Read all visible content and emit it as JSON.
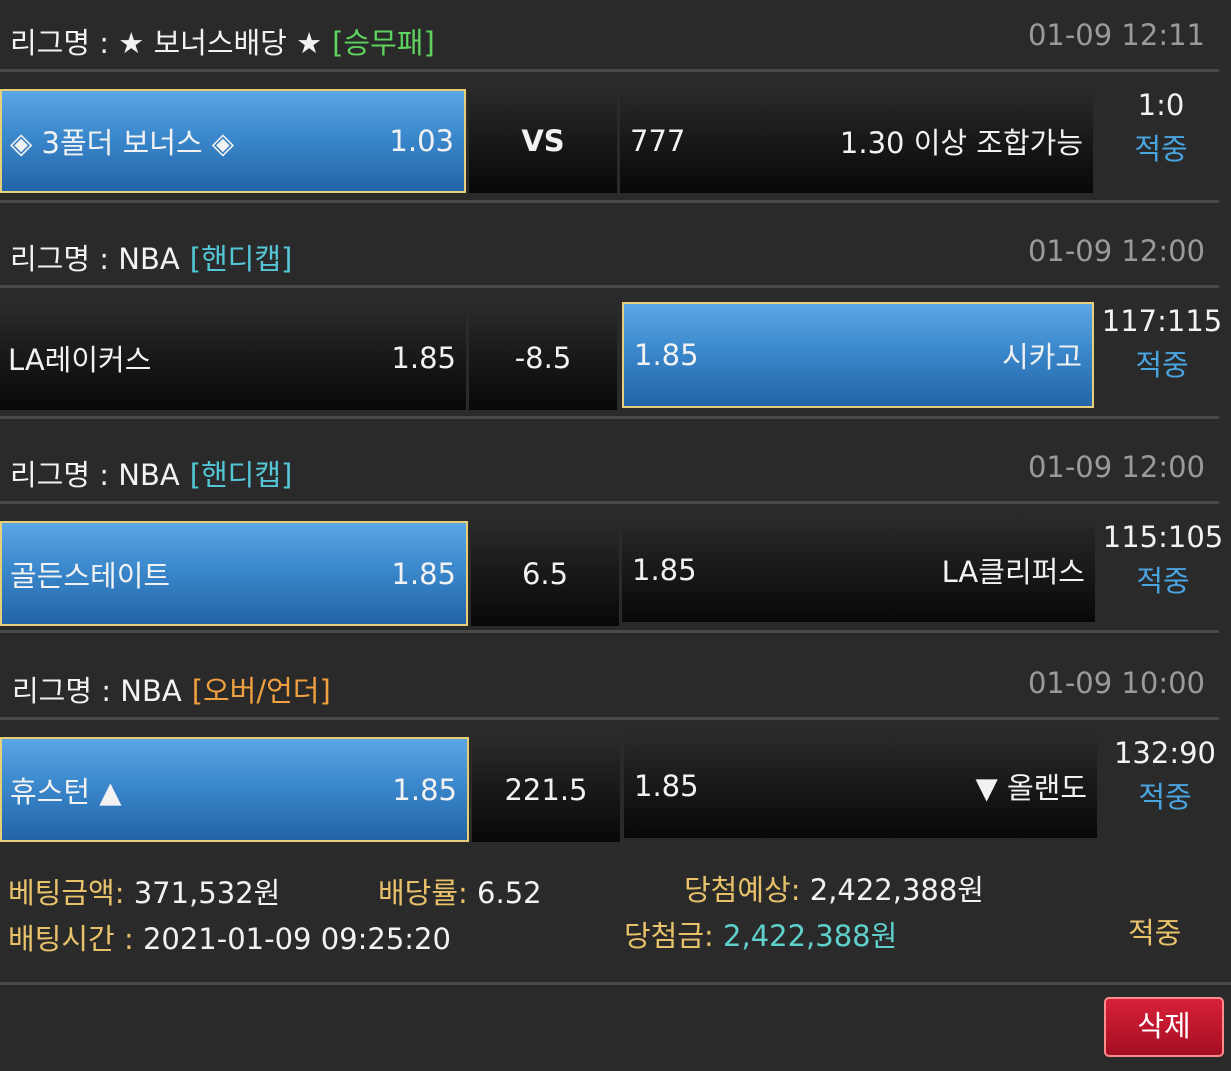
{
  "colors": {
    "selected_fill": "#3b88cc",
    "selected_border": "#e7cf7a",
    "type_win_draw_lose": "#5fd35f",
    "type_handicap": "#55c6d8",
    "type_over_under": "#f0a040",
    "result_blue": "#4aa4e0",
    "gold_label": "#e8c26a",
    "cyan_value": "#5fd0cc",
    "delete_red": "#c8162e"
  },
  "matches": [
    {
      "league_prefix": "리그명 : ★ 보너스배당 ★",
      "bet_type": "[승무패]",
      "time": "01-09 12:11",
      "home_team": "◈ 3폴더 보너스 ◈",
      "home_odds": "1.03",
      "middle": "VS",
      "away_odds": "777",
      "away_team": "1.30 이상 조합가능",
      "score": "1:0",
      "result": "적중",
      "selected": "home"
    },
    {
      "league_prefix": "리그명 : NBA",
      "bet_type": "[핸디캡]",
      "time": "01-09 12:00",
      "home_team": "LA레이커스",
      "home_odds": "1.85",
      "middle": "-8.5",
      "away_odds": "1.85",
      "away_team": "시카고",
      "score": "117:115",
      "result": "적중",
      "selected": "away"
    },
    {
      "league_prefix": "리그명 : NBA",
      "bet_type": "[핸디캡]",
      "time": "01-09 12:00",
      "home_team": "골든스테이트",
      "home_odds": "1.85",
      "middle": "6.5",
      "away_odds": "1.85",
      "away_team": "LA클리퍼스",
      "score": "115:105",
      "result": "적중",
      "selected": "home"
    },
    {
      "league_prefix": "리그명 : NBA",
      "bet_type": "[오버/언더]",
      "time": "01-09 10:00",
      "home_team": "휴스턴 ▲",
      "home_odds": "1.85",
      "middle": "221.5",
      "away_odds": "1.85",
      "away_team": "▼ 올랜도",
      "score": "132:90",
      "result": "적중",
      "selected": "home"
    }
  ],
  "summary": {
    "bet_amount_label": "베팅금액:",
    "bet_amount_value": "371,532원",
    "odds_rate_label": "배당률:",
    "odds_rate_value": "6.52",
    "expected_win_label": "당첨예상:",
    "expected_win_value": "2,422,388원",
    "bet_time_label": "배팅시간 :",
    "bet_time_value": "2021-01-09 09:25:20",
    "win_amount_label": "당첨금:",
    "win_amount_value": "2,422,388원",
    "status": "적중"
  },
  "delete_label": "삭제"
}
